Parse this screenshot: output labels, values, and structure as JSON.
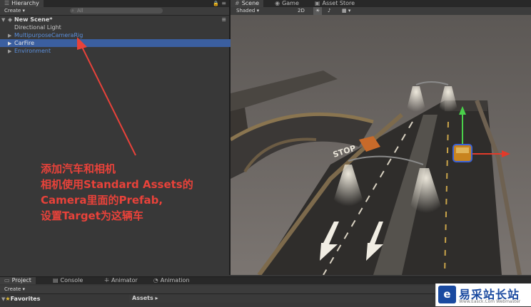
{
  "hierarchy": {
    "tab_label": "Hierarchy",
    "create_label": "Create",
    "search_placeholder": "All",
    "scene_name": "New Scene*",
    "items": [
      {
        "label": "Directional Light"
      },
      {
        "label": "MultipurposeCameraRig"
      },
      {
        "label": "CarFire"
      },
      {
        "label": "Environment"
      }
    ]
  },
  "scene_tabs": {
    "scene": "Scene",
    "game": "Game",
    "asset_store": "Asset Store"
  },
  "scene_toolbar": {
    "shading_mode": "Shaded",
    "mode_2d": "2D"
  },
  "viewport": {
    "road_text": "STOP"
  },
  "annotation": {
    "line1": "添加汽车和相机",
    "line2": "相机使用Standard Assets的",
    "line3": "Camera里面的Prefab,",
    "line4": "设置Target为这辆车",
    "color": "#e8423a"
  },
  "bottom_tabs": {
    "project": "Project",
    "console": "Console",
    "animator": "Animator",
    "animation": "Animation"
  },
  "project": {
    "create_label": "Create",
    "favorites_label": "Favorites",
    "assets_label": "Assets ▸"
  },
  "watermark": {
    "title": "易采站长站",
    "subtitle": "Www.Easck.Com  Webmaster"
  },
  "colors": {
    "selection": "#3b5fa0",
    "prefab_blue": "#5b8fdc",
    "panel_bg": "#383838"
  }
}
